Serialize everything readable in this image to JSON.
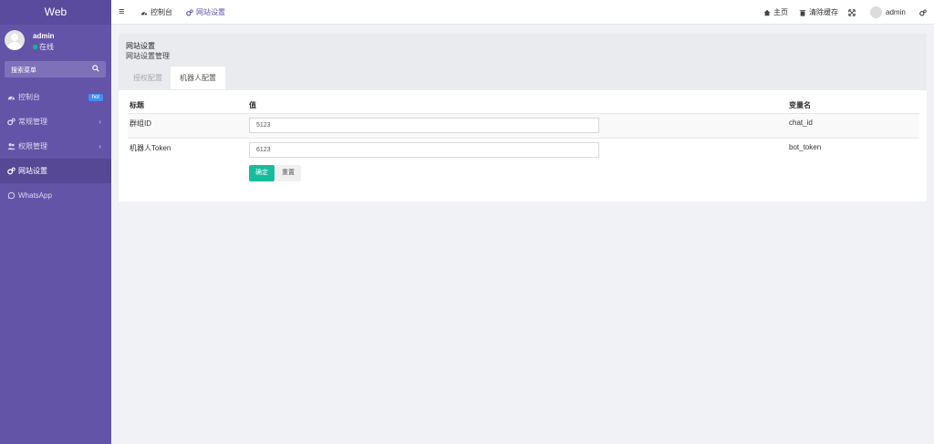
{
  "brand": "Web",
  "user": {
    "name": "admin",
    "status": "在线"
  },
  "search": {
    "label": "搜索菜单"
  },
  "menu": [
    {
      "label": "控制台",
      "icon": "dashboard-icon",
      "badge": "hot"
    },
    {
      "label": "常规管理",
      "icon": "cogs-icon",
      "chevron": "‹"
    },
    {
      "label": "权限管理",
      "icon": "users-icon",
      "chevron": "‹"
    },
    {
      "label": "网站设置",
      "icon": "cogs-icon",
      "active": true
    },
    {
      "label": "WhatsApp",
      "icon": "whatsapp-icon"
    }
  ],
  "header": {
    "menu_toggle": "≡",
    "tabs": [
      {
        "label": "控制台",
        "icon": "dashboard-icon"
      },
      {
        "label": "网站设置",
        "icon": "cogs-icon",
        "active": true
      }
    ],
    "right": {
      "home": "主页",
      "clear_cache": "清除缓存",
      "user": "admin"
    }
  },
  "page": {
    "title": "网站设置",
    "subtitle": "网站设置管理",
    "tabs": [
      {
        "label": "授权配置",
        "active": false
      },
      {
        "label": "机器人配置",
        "active": true
      }
    ]
  },
  "table": {
    "headers": {
      "title": "标题",
      "value": "值",
      "var": "变量名"
    },
    "rows": [
      {
        "title": "群组ID",
        "value": "5123",
        "var": "chat_id"
      },
      {
        "title": "机器人Token",
        "value": "6123",
        "var": "bot_token"
      }
    ]
  },
  "buttons": {
    "confirm": "确定",
    "reset": "重置"
  },
  "colors": {
    "sidebar": "#6354a8",
    "accent": "#6354a8",
    "primary_button": "#18bc9c",
    "badge": "#3f8ef5",
    "online": "#00c38a"
  }
}
